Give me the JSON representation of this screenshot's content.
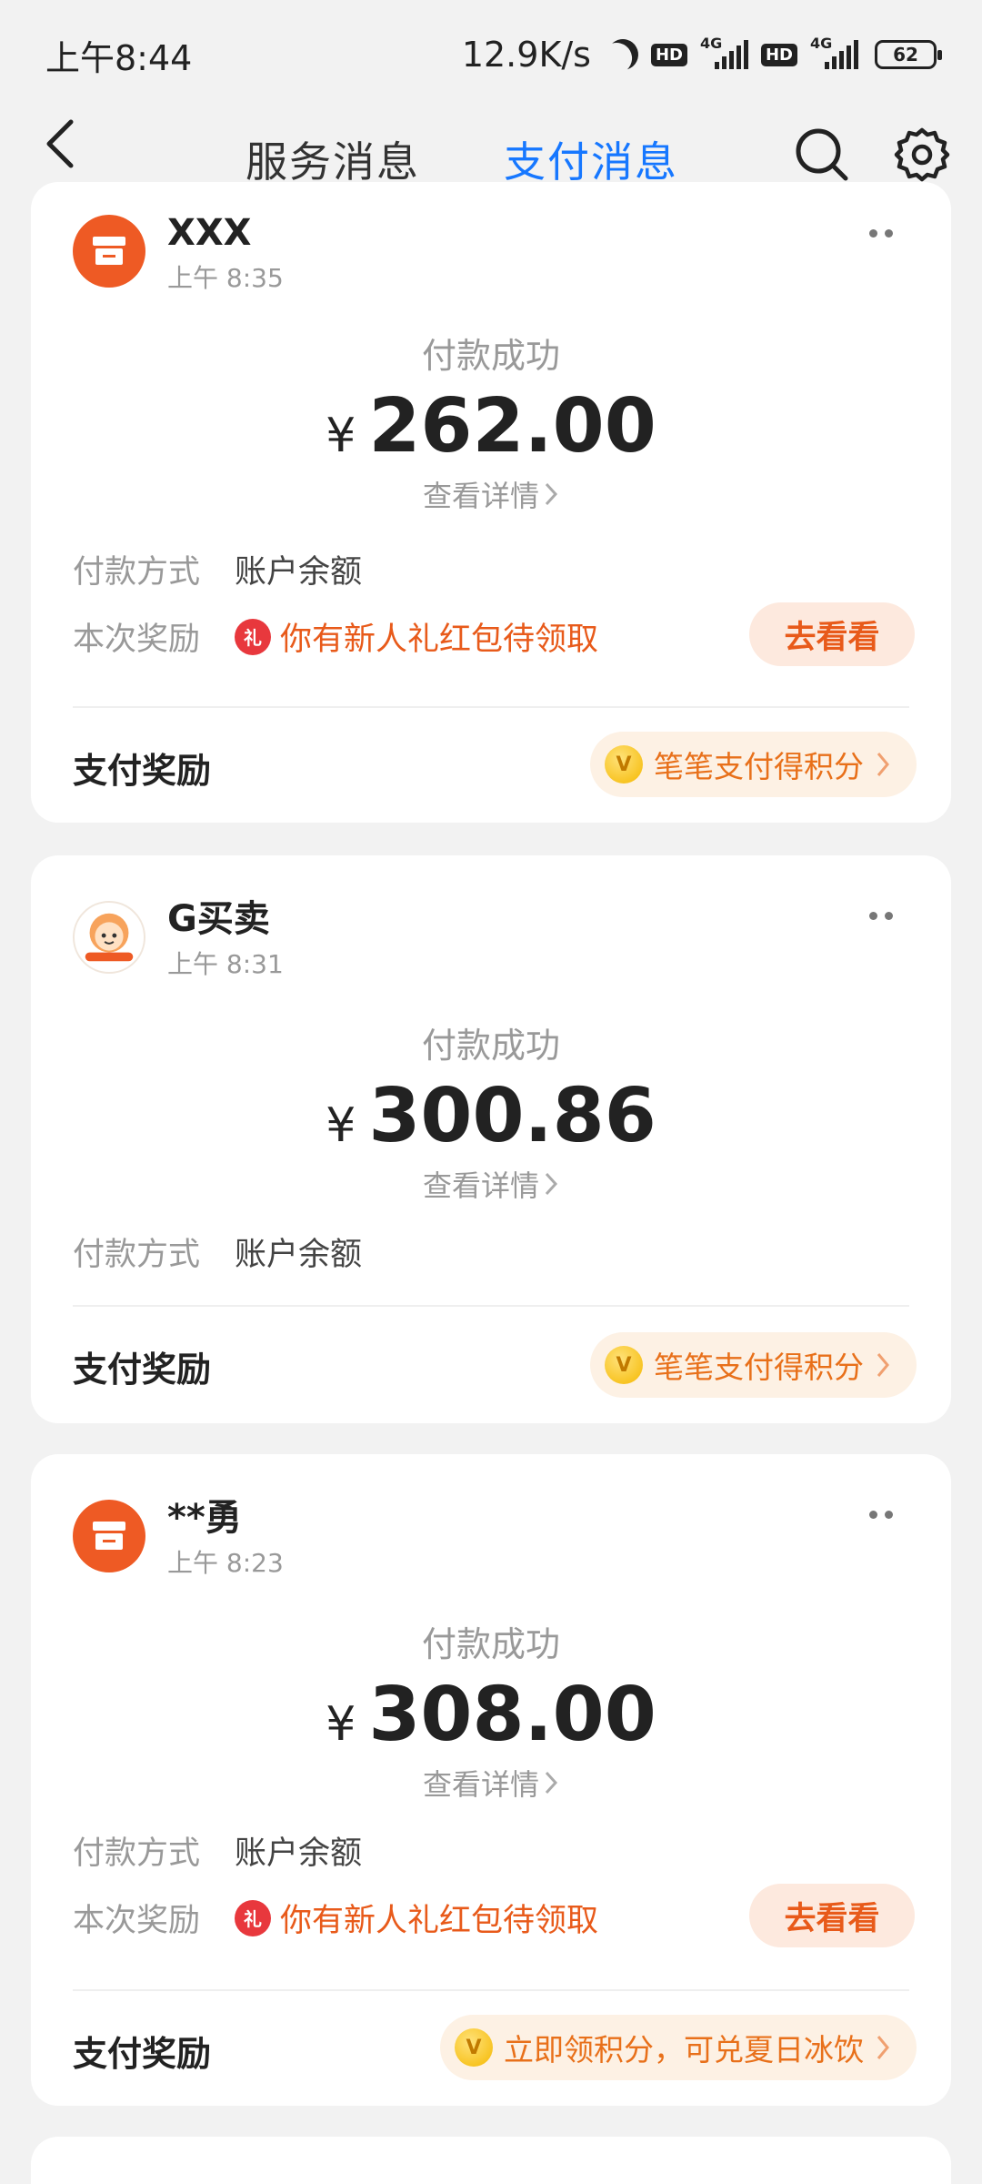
{
  "status_bar": {
    "time": "上午8:44",
    "speed": "12.9K/s",
    "hd": "HD",
    "network": "4G",
    "battery": "62"
  },
  "nav": {
    "tabs": [
      {
        "label": "服务消息",
        "active": false
      },
      {
        "label": "支付消息",
        "active": true
      }
    ],
    "icons": [
      "back-icon",
      "search-icon",
      "gear-icon"
    ]
  },
  "messages": [
    {
      "merchant": "XXX",
      "time": "上午 8:35",
      "status": "付款成功",
      "currency": "¥",
      "amount": "262.00",
      "detail_link": "查看详情",
      "method_label": "付款方式",
      "method_value": "账户余额",
      "reward_label": "本次奖励",
      "gift_glyph": "礼",
      "reward_text": "你有新人礼红包待领取",
      "reward_button": "去看看",
      "pay_reward_label": "支付奖励",
      "coin_glyph": "V",
      "pay_reward_pill": "笔笔支付得积分"
    },
    {
      "merchant": "G买卖",
      "time": "上午 8:31",
      "status": "付款成功",
      "currency": "¥",
      "amount": "300.86",
      "detail_link": "查看详情",
      "method_label": "付款方式",
      "method_value": "账户余额",
      "pay_reward_label": "支付奖励",
      "coin_glyph": "V",
      "pay_reward_pill": "笔笔支付得积分"
    },
    {
      "merchant": "**勇",
      "time": "上午 8:23",
      "status": "付款成功",
      "currency": "¥",
      "amount": "308.00",
      "detail_link": "查看详情",
      "method_label": "付款方式",
      "method_value": "账户余额",
      "reward_label": "本次奖励",
      "gift_glyph": "礼",
      "reward_text": "你有新人礼红包待领取",
      "reward_button": "去看看",
      "pay_reward_label": "支付奖励",
      "coin_glyph": "V",
      "pay_reward_pill": "立即领积分，可兑夏日冰饮"
    }
  ],
  "colors": {
    "accent": "#1677ff",
    "reward_orange": "#e85a1a",
    "merchant_icon": "#ee5a24"
  }
}
